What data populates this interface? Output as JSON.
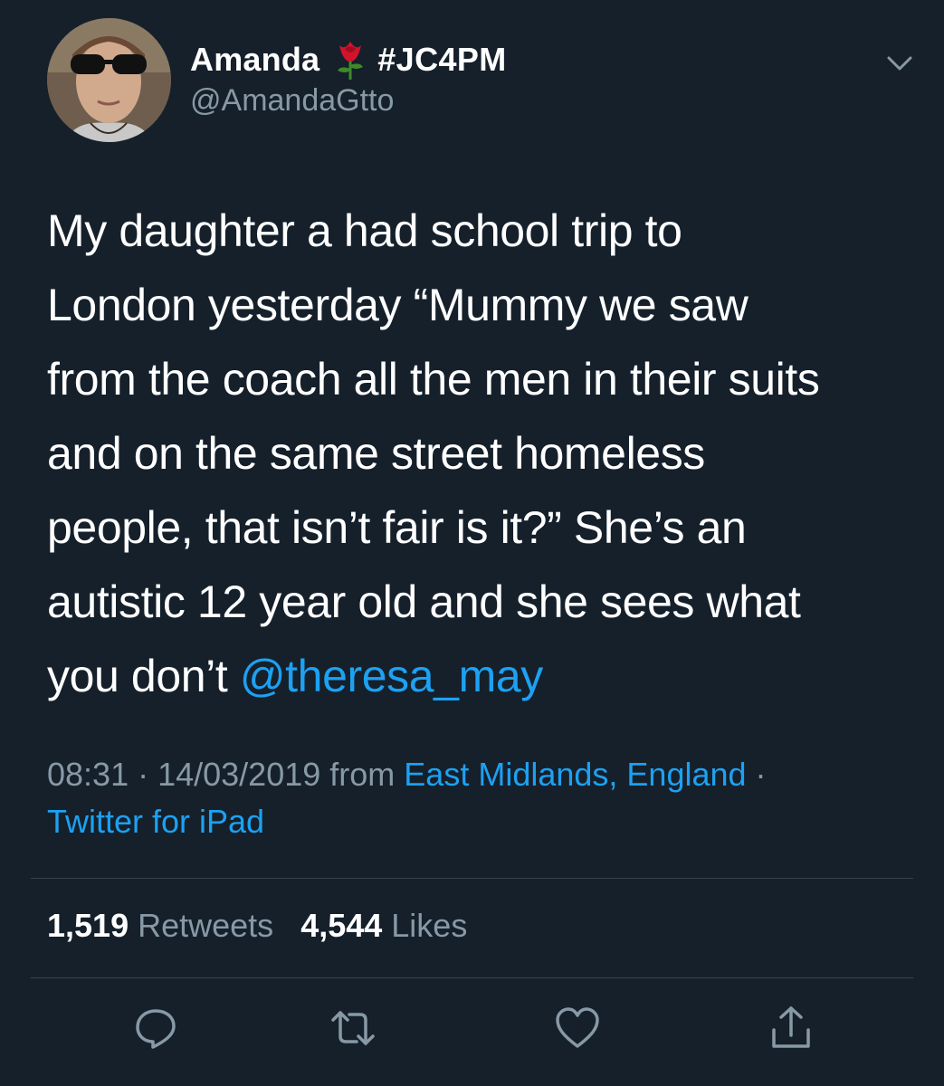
{
  "user": {
    "display_name": "Amanda",
    "emoji_icon": "rose-icon",
    "hashtag": "#JC4PM",
    "handle": "@AmandaGtto"
  },
  "tweet": {
    "lines": [
      "My daughter a had school trip to",
      "London yesterday “Mummy we saw",
      "from the coach all the men in their suits",
      "and on the same street homeless",
      "people, that isn’t fair is it?” She’s an",
      "autistic 12 year old and she sees what"
    ],
    "last_line_prefix": "you don’t ",
    "mention": "@theresa_may"
  },
  "meta": {
    "time": "08:31",
    "separator": " · ",
    "date": "14/03/2019",
    "from_word": " from ",
    "location": "East Midlands, England",
    "separator_end": " ·",
    "source": "Twitter for iPad"
  },
  "stats": {
    "retweets_count": "1,519",
    "retweets_label": " Retweets",
    "likes_count": "4,544",
    "likes_label": " Likes"
  },
  "actions": [
    "reply-icon",
    "retweet-icon",
    "like-icon",
    "share-icon"
  ],
  "colors": {
    "background": "#15202b",
    "text": "#ffffff",
    "secondary": "#8899a6",
    "link": "#1da1f2",
    "divider": "#38444d"
  }
}
